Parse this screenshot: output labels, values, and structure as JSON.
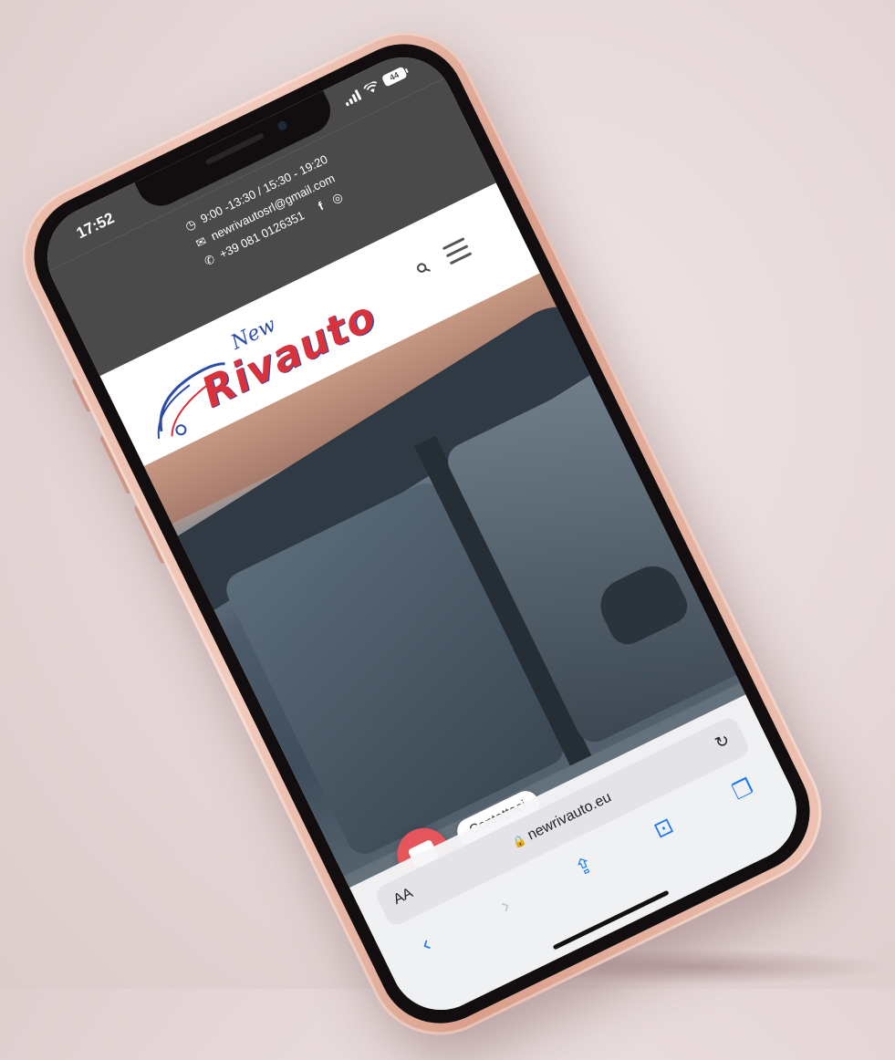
{
  "status_bar": {
    "time": "17:52",
    "battery": "44"
  },
  "contact_bar": {
    "hours": "9:00 -13:30 / 15:30 - 19:20",
    "email": "newrivautosrl@gmail.com",
    "phone": "+39 081 0126351",
    "icons": [
      "clock-icon",
      "mail-icon",
      "phone-icon",
      "facebook-icon",
      "instagram-icon"
    ]
  },
  "logo": {
    "top_word": "New",
    "main_word": "Rivauto"
  },
  "header": {
    "icons": [
      "search-icon",
      "menu-icon"
    ]
  },
  "chat": {
    "label": "Contattaci"
  },
  "safari": {
    "text_size_label": "AA",
    "url": "newrivauto.eu",
    "toolbar_icons": [
      "back-icon",
      "forward-icon",
      "share-icon",
      "bookmarks-icon",
      "tabs-icon"
    ]
  },
  "colors": {
    "topbar": "#4a4a4a",
    "logo_red": "#d8323c",
    "logo_blue": "#2c4aa8",
    "chat_button": "#e4565b",
    "safari_blue": "#1a7bf2",
    "phone_frame": "#efc4b3"
  }
}
